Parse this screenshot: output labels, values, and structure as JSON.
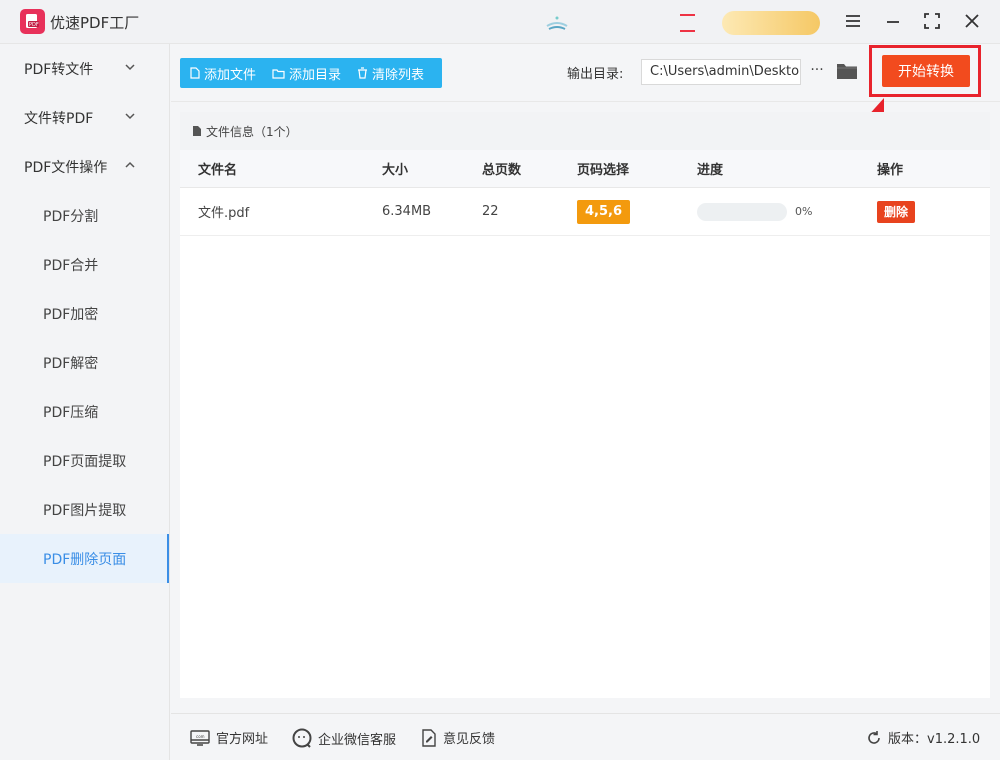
{
  "app": {
    "title": "优速PDF工厂"
  },
  "sidebar": {
    "groups": [
      {
        "label": "PDF转文件"
      },
      {
        "label": "文件转PDF"
      },
      {
        "label": "PDF文件操作"
      }
    ],
    "subitems": [
      {
        "label": "PDF分割"
      },
      {
        "label": "PDF合并"
      },
      {
        "label": "PDF加密"
      },
      {
        "label": "PDF解密"
      },
      {
        "label": "PDF压缩"
      },
      {
        "label": "PDF页面提取"
      },
      {
        "label": "PDF图片提取"
      },
      {
        "label": "PDF删除页面"
      }
    ],
    "active_item": "PDF删除页面"
  },
  "toolbar": {
    "add_file": "添加文件",
    "add_folder": "添加目录",
    "clear_list": "清除列表",
    "output_label": "输出目录:",
    "output_path": "C:\\Users\\admin\\Desktop",
    "more": "···",
    "start": "开始转换"
  },
  "panel": {
    "info": "文件信息（1个）",
    "columns": {
      "name": "文件名",
      "size": "大小",
      "pages": "总页数",
      "page_select": "页码选择",
      "progress": "进度",
      "action": "操作"
    },
    "rows": [
      {
        "name": "文件.pdf",
        "size": "6.34MB",
        "pages": "22",
        "page_select": "4,5,6",
        "progress": 0,
        "progress_label": "0%",
        "action": "删除"
      }
    ]
  },
  "footer": {
    "website": "官方网址",
    "support": "企业微信客服",
    "feedback": "意见反馈",
    "version": "版本：v1.2.1.0"
  },
  "colors": {
    "accent_blue": "#2bb3f0",
    "start_button": "#f24b1e",
    "highlight": "#e8232c",
    "page_badge": "#f39a0e"
  }
}
